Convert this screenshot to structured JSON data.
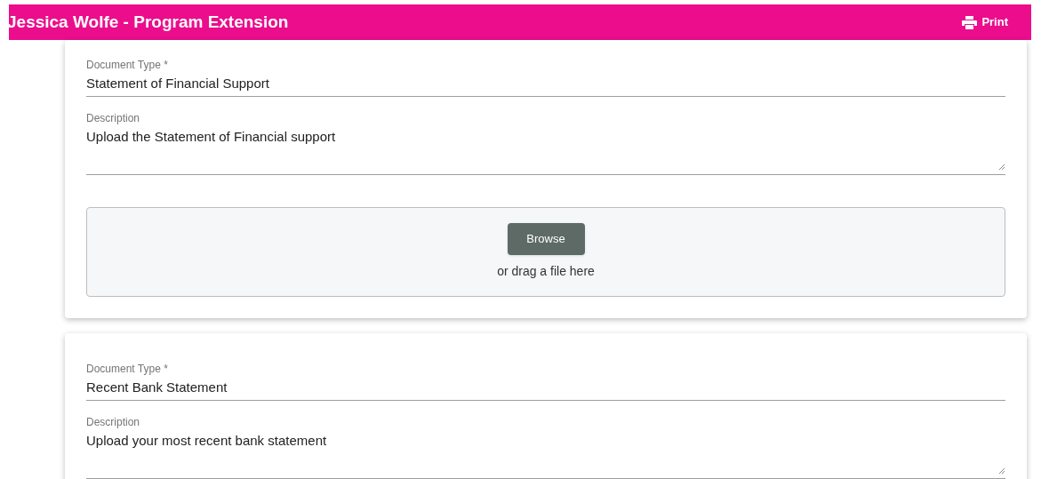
{
  "header": {
    "title": "Jessica Wolfe - Program Extension",
    "print_label": "Print"
  },
  "documents": [
    {
      "type_label": "Document Type *",
      "type_value": "Statement of Financial Support",
      "description_label": "Description",
      "description_value": "Upload the Statement of Financial support",
      "dropzone": {
        "button": "Browse",
        "hint": "or drag a file here"
      }
    },
    {
      "type_label": "Document Type *",
      "type_value": "Recent Bank Statement",
      "description_label": "Description",
      "description_value": "Upload your most recent bank statement"
    }
  ]
}
